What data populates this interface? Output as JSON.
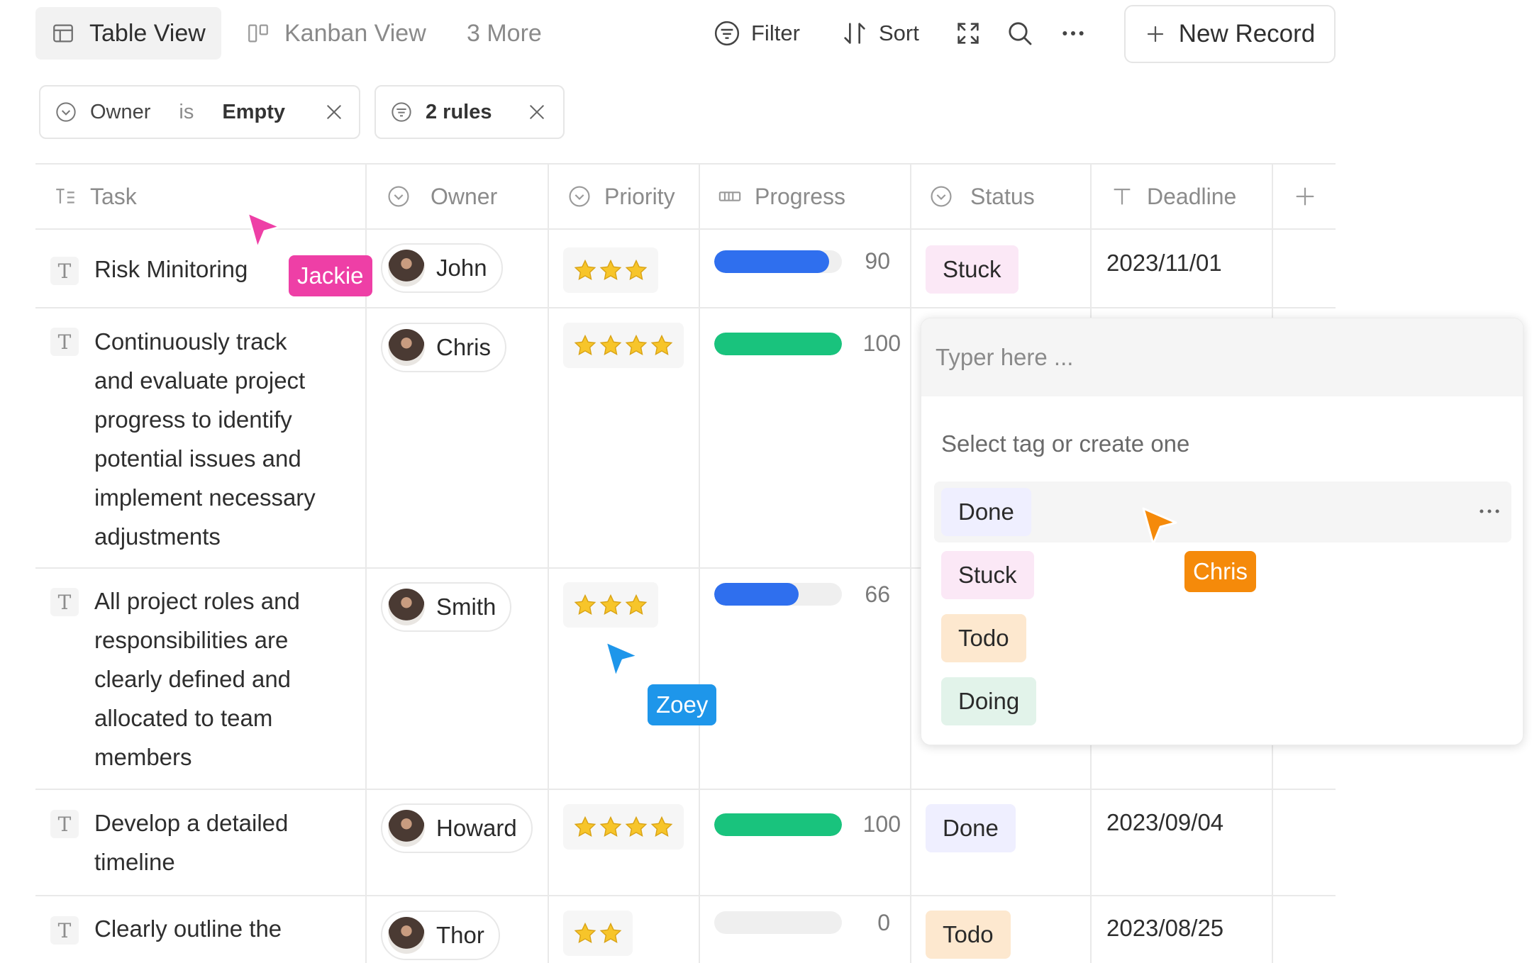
{
  "toolbar": {
    "views": [
      {
        "label": "Table View",
        "icon": "table-icon",
        "active": true
      },
      {
        "label": "Kanban View",
        "icon": "kanban-icon",
        "active": false
      }
    ],
    "more_views": "3 More",
    "filter_label": "Filter",
    "sort_label": "Sort",
    "new_record_label": "New Record"
  },
  "filters": {
    "rule1": {
      "field": "Owner",
      "operator": "is",
      "value": "Empty"
    },
    "rule2": {
      "label": "2 rules"
    }
  },
  "table": {
    "columns": [
      {
        "label": "Task",
        "icon": "text-list-icon"
      },
      {
        "label": "Owner",
        "icon": "circle-chevron-icon"
      },
      {
        "label": "Priority",
        "icon": "circle-chevron-icon"
      },
      {
        "label": "Progress",
        "icon": "progress-icon"
      },
      {
        "label": "Status",
        "icon": "circle-chevron-icon"
      },
      {
        "label": "Deadline",
        "icon": "text-icon"
      }
    ],
    "rows": [
      {
        "task_lines": [
          "Risk Minitoring"
        ],
        "owner": "John",
        "priority": 3,
        "progress": 90,
        "status": "Stuck",
        "deadline": "2023/11/01"
      },
      {
        "task_lines": [
          "Continuously track",
          "and evaluate project",
          "progress to identify",
          "potential issues and",
          "implement necessary",
          "adjustments"
        ],
        "owner": "Chris",
        "priority": 4,
        "progress": 100,
        "status": "",
        "deadline": ""
      },
      {
        "task_lines": [
          "All project roles and",
          "responsibilities are",
          "clearly defined and",
          "allocated to team",
          "members"
        ],
        "owner": "Smith",
        "priority": 3,
        "progress": 66,
        "status": "",
        "deadline": ""
      },
      {
        "task_lines": [
          "Develop a detailed",
          "timeline"
        ],
        "owner": "Howard",
        "priority": 4,
        "progress": 100,
        "status": "Done",
        "deadline": "2023/09/04"
      },
      {
        "task_lines": [
          "Clearly outline the"
        ],
        "owner": "Thor",
        "priority": 2,
        "progress": 0,
        "status": "Todo",
        "deadline": "2023/08/25"
      }
    ]
  },
  "status_dropdown": {
    "placeholder": "Typer here ...",
    "hint": "Select tag or create one",
    "options": [
      "Done",
      "Stuck",
      "Todo",
      "Doing"
    ]
  },
  "collaborators": [
    {
      "name": "Jackie",
      "color": "#ee3fa6"
    },
    {
      "name": "Chris",
      "color": "#f58a0a"
    },
    {
      "name": "Zoey",
      "color": "#1e96ea"
    }
  ],
  "colors": {
    "progress_blue": "#2f6fee",
    "progress_green": "#19c37d",
    "status_stuck": "#fbe8f6",
    "status_done": "#efefff",
    "status_todo": "#fde8cf",
    "status_doing": "#e2f3ea",
    "star": "#f7c52a"
  }
}
